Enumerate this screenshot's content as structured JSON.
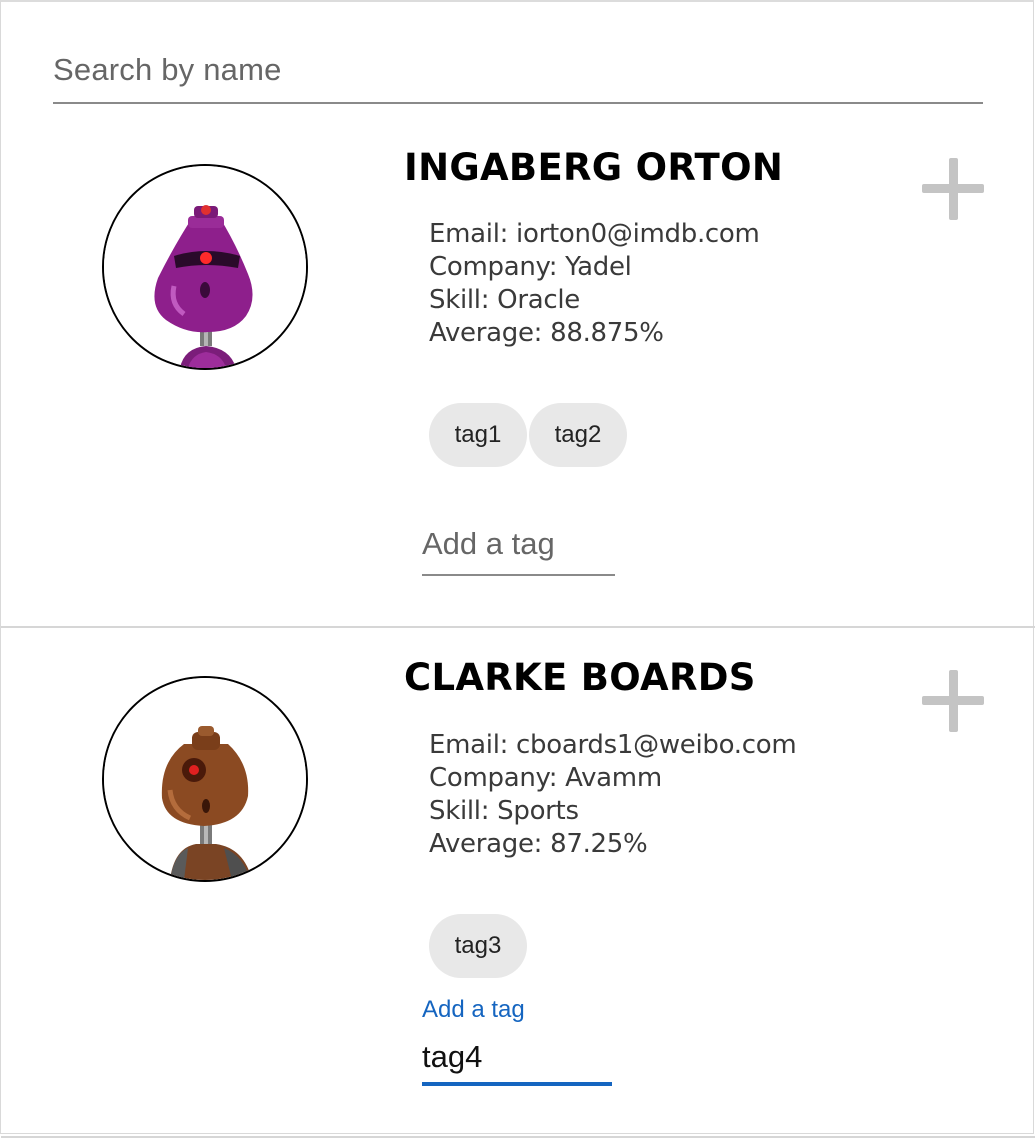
{
  "search": {
    "placeholder": "Search by name",
    "value": ""
  },
  "students": [
    {
      "name": "INGABERG ORTON",
      "email": "Email: iorton0@imdb.com",
      "company": "Company: Yadel",
      "skill": "Skill: Oracle",
      "average": "Average: 88.875%",
      "tags": [
        "tag1",
        "tag2"
      ],
      "tag_input": {
        "placeholder": "Add a tag",
        "value": ""
      },
      "avatar_color": "#8e1f8c"
    },
    {
      "name": "CLARKE BOARDS",
      "email": "Email: cboards1@weibo.com",
      "company": "Company: Avamm",
      "skill": "Skill: Sports",
      "average": "Average: 87.25%",
      "tags": [
        "tag3"
      ],
      "tag_input": {
        "label": "Add a tag",
        "value": "tag4"
      },
      "avatar_color": "#8b4a22"
    }
  ],
  "colors": {
    "accent": "#1565c0",
    "tag_bg": "#e8e8e8",
    "plus_icon": "#c4c4c4"
  },
  "icons": {
    "expand": "plus-icon"
  }
}
